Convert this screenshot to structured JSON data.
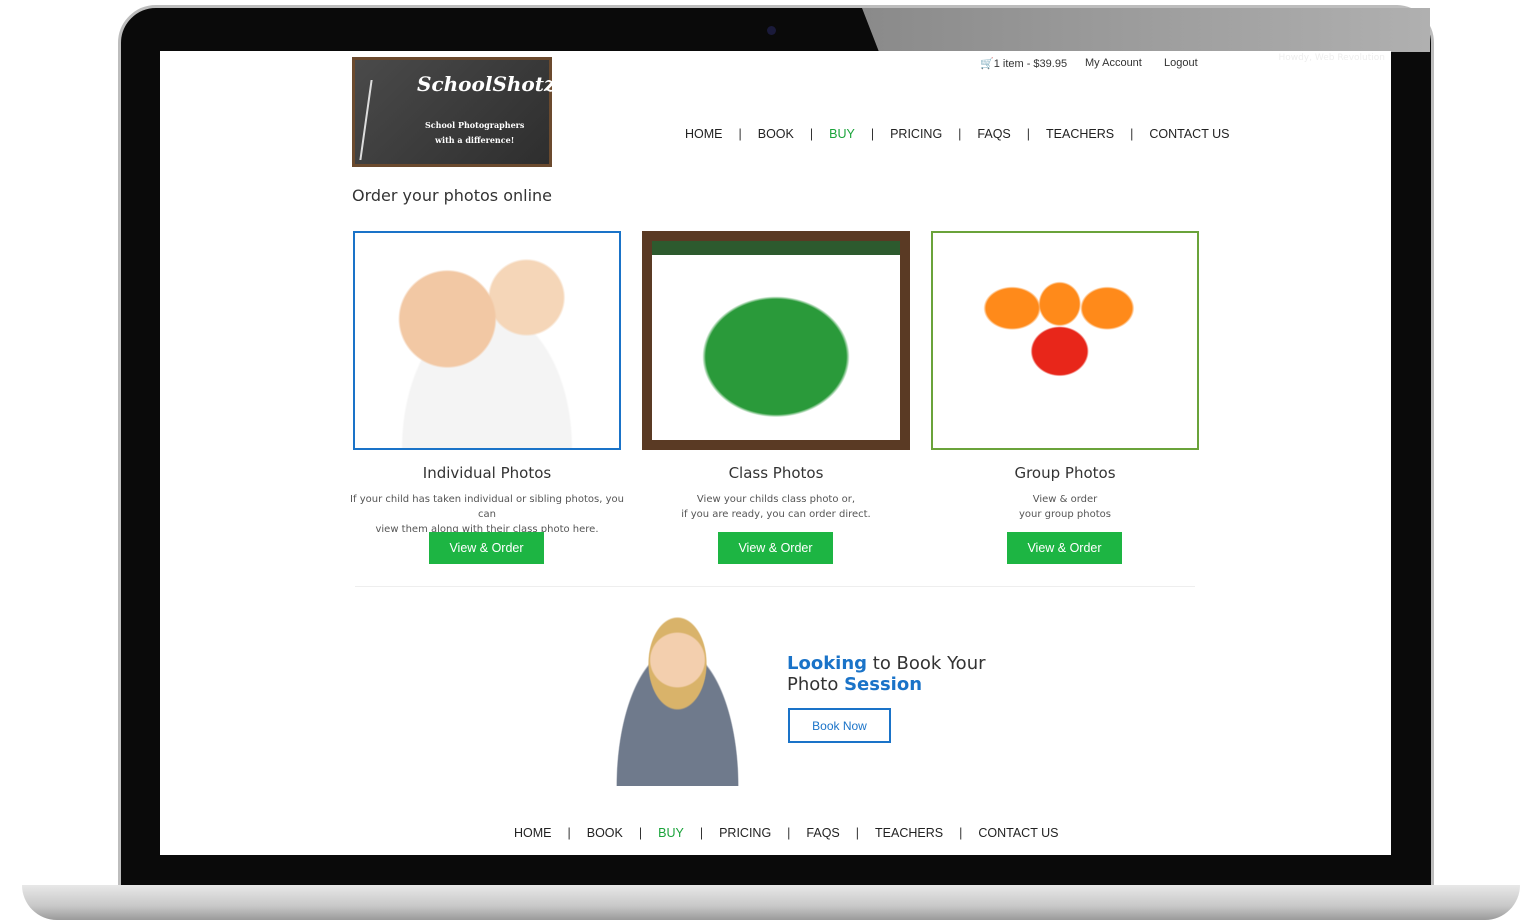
{
  "logo": {
    "title": "SchoolShotz",
    "tagline_1": "School Photographers",
    "tagline_2": "with a difference!"
  },
  "topbar": {
    "cart": "1 item - $39.95",
    "account": "My Account",
    "logout": "Logout",
    "howdy": "Howdy, Web Revolution"
  },
  "nav": [
    "HOME",
    "BOOK",
    "BUY",
    "PRICING",
    "FAQS",
    "TEACHERS",
    "CONTACT US"
  ],
  "nav_active": "BUY",
  "heading": "Order your photos online",
  "cards": [
    {
      "title": "Individual Photos",
      "desc_1": "If your child has taken individual or sibling photos, you can",
      "desc_2": "view them along with their class photo here.",
      "button": "View & Order",
      "border": "#1a73c8"
    },
    {
      "title": "Class Photos",
      "desc_1": "View your childs class photo or,",
      "desc_2": "if you are ready, you can order direct.",
      "button": "View & Order",
      "border": "#5a3a24"
    },
    {
      "title": "Group Photos",
      "desc_1": "View & order",
      "desc_2": "your group photos",
      "button": "View & Order",
      "border": "#6aa33a"
    }
  ],
  "booking": {
    "w1": "Looking",
    "w2": " to Book Your",
    "w3": "Photo ",
    "w4": "Session",
    "button": "Book Now"
  },
  "colors": {
    "green": "#1db543",
    "blue": "#1a73c8"
  }
}
